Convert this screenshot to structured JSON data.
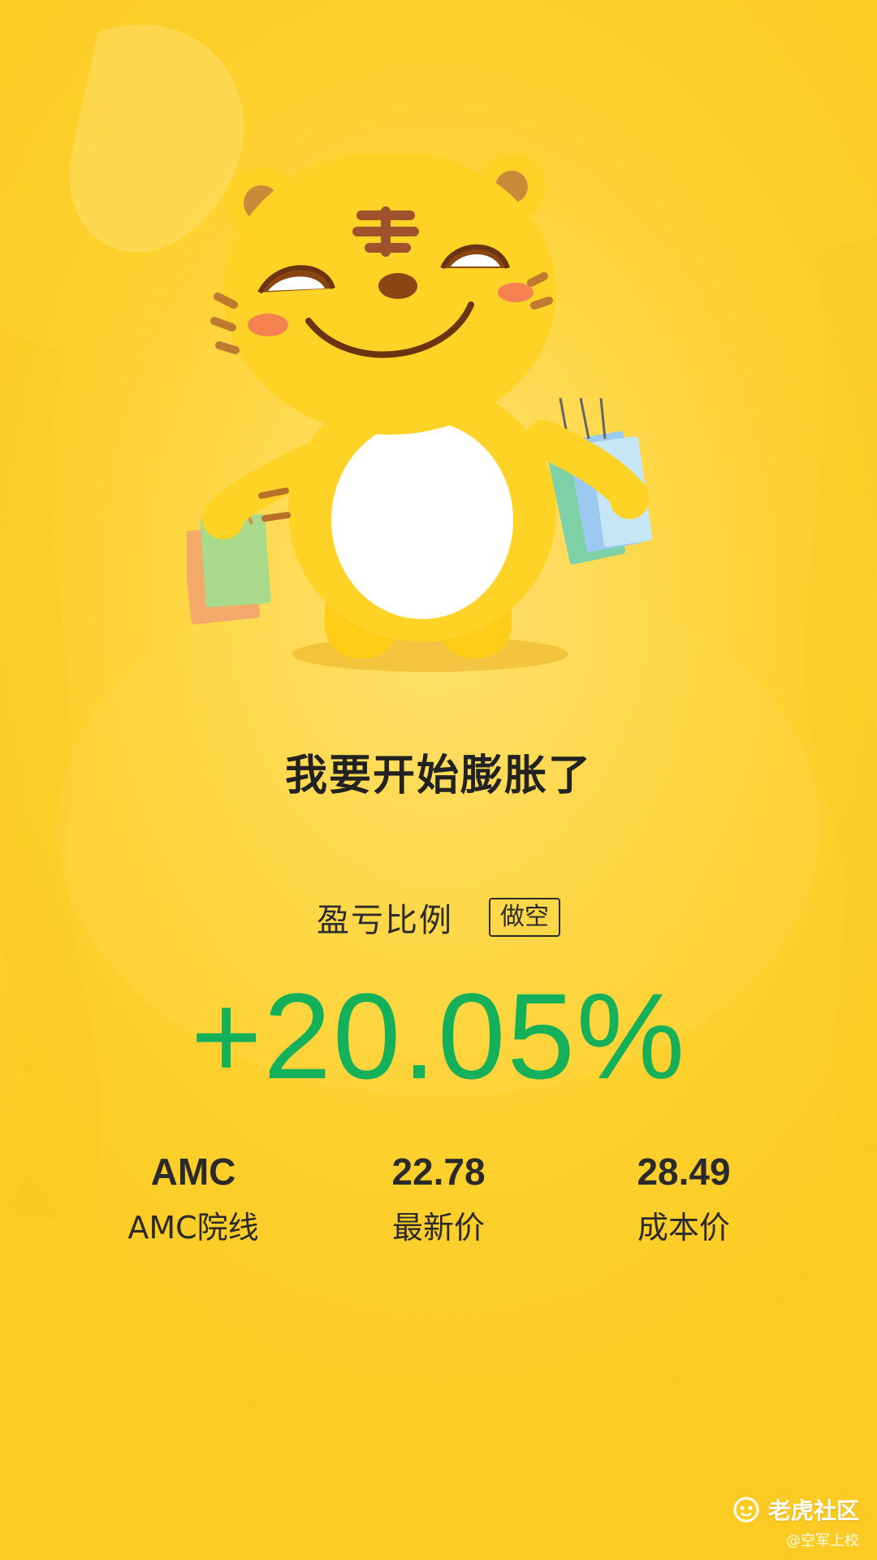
{
  "headline": "我要开始膨胀了",
  "profit_loss": {
    "label": "盈亏比例",
    "badge": "做空",
    "value": "+20.05%"
  },
  "stats": [
    {
      "top": "AMC",
      "bottom": "AMC院线"
    },
    {
      "top": "22.78",
      "bottom": "最新价"
    },
    {
      "top": "28.49",
      "bottom": "成本价"
    }
  ],
  "brand": {
    "name": "老虎社区",
    "icon": "tiger-logo-icon"
  },
  "credit": "@空军上校",
  "colors": {
    "background": "#fdd12f",
    "gain": "#14b05a",
    "text": "#2a2a2a"
  },
  "mascot": {
    "icon": "tiger-mascot-shopping-bags"
  }
}
